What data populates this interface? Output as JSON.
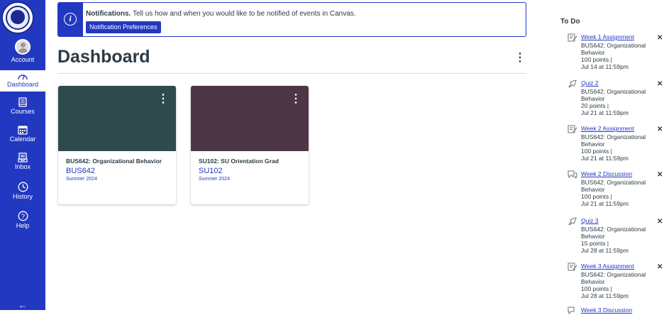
{
  "nav": {
    "items": [
      {
        "label": "Account",
        "icon": "account-avatar"
      },
      {
        "label": "Dashboard",
        "icon": "dashboard-icon"
      },
      {
        "label": "Courses",
        "icon": "courses-icon"
      },
      {
        "label": "Calendar",
        "icon": "calendar-icon"
      },
      {
        "label": "Inbox",
        "icon": "inbox-icon"
      },
      {
        "label": "History",
        "icon": "history-icon"
      },
      {
        "label": "Help",
        "icon": "help-icon"
      }
    ],
    "collapse_glyph": "←",
    "colors": {
      "nav_bg": "#2338c0",
      "accent": "#2338c0"
    }
  },
  "notification": {
    "title": "Notifications.",
    "message": "Tell us how and when you would like to be notified of events in Canvas.",
    "button_label": "Notification Preferences",
    "info_glyph": "i"
  },
  "page": {
    "title": "Dashboard",
    "options_glyph": "⋮"
  },
  "cards": [
    {
      "name": "BUS642: Organizational Behavior",
      "code": "BUS642",
      "term": "Summer 2024",
      "color": "#2f4a4c"
    },
    {
      "name": "SU102: SU Orientation Grad",
      "code": "SU102",
      "term": "Summer 2024",
      "color": "#4d3746"
    }
  ],
  "card_options_glyph": "⋮",
  "todo": {
    "title": "To Do",
    "dismiss_glyph": "✕",
    "items": [
      {
        "icon": "assignment-icon",
        "title": "Week 1 Assignment",
        "course_a": "BUS642: Organizational",
        "course_b": "Behavior",
        "points": "100 points  |",
        "due": "Jul 14 at 11:59pm"
      },
      {
        "icon": "quiz-icon",
        "title": "Quiz 2",
        "course_a": "BUS642: Organizational",
        "course_b": "Behavior",
        "points": "20 points  |",
        "due": "Jul 21 at 11:59pm"
      },
      {
        "icon": "assignment-icon",
        "title": "Week 2 Assignment",
        "course_a": "BUS642: Organizational",
        "course_b": "Behavior",
        "points": "100 points  |",
        "due": "Jul 21 at 11:59pm"
      },
      {
        "icon": "discussion-icon",
        "title": "Week 2 Discussion",
        "course_a": "BUS642: Organizational",
        "course_b": "Behavior",
        "points": "100 points  |",
        "due": "Jul 21 at 11:59pm"
      },
      {
        "icon": "quiz-icon",
        "title": "Quiz 3",
        "course_a": "BUS642: Organizational",
        "course_b": "Behavior",
        "points": "15 points  |",
        "due": "Jul 28 at 11:59pm"
      },
      {
        "icon": "assignment-icon",
        "title": "Week 3 Assignment",
        "course_a": "BUS642: Organizational",
        "course_b": "Behavior",
        "points": "100 points  |",
        "due": "Jul 28 at 11:59pm"
      },
      {
        "icon": "discussion-icon",
        "title": "Week 3 Discussion",
        "course_a": "",
        "course_b": "",
        "points": "",
        "due": ""
      }
    ]
  }
}
